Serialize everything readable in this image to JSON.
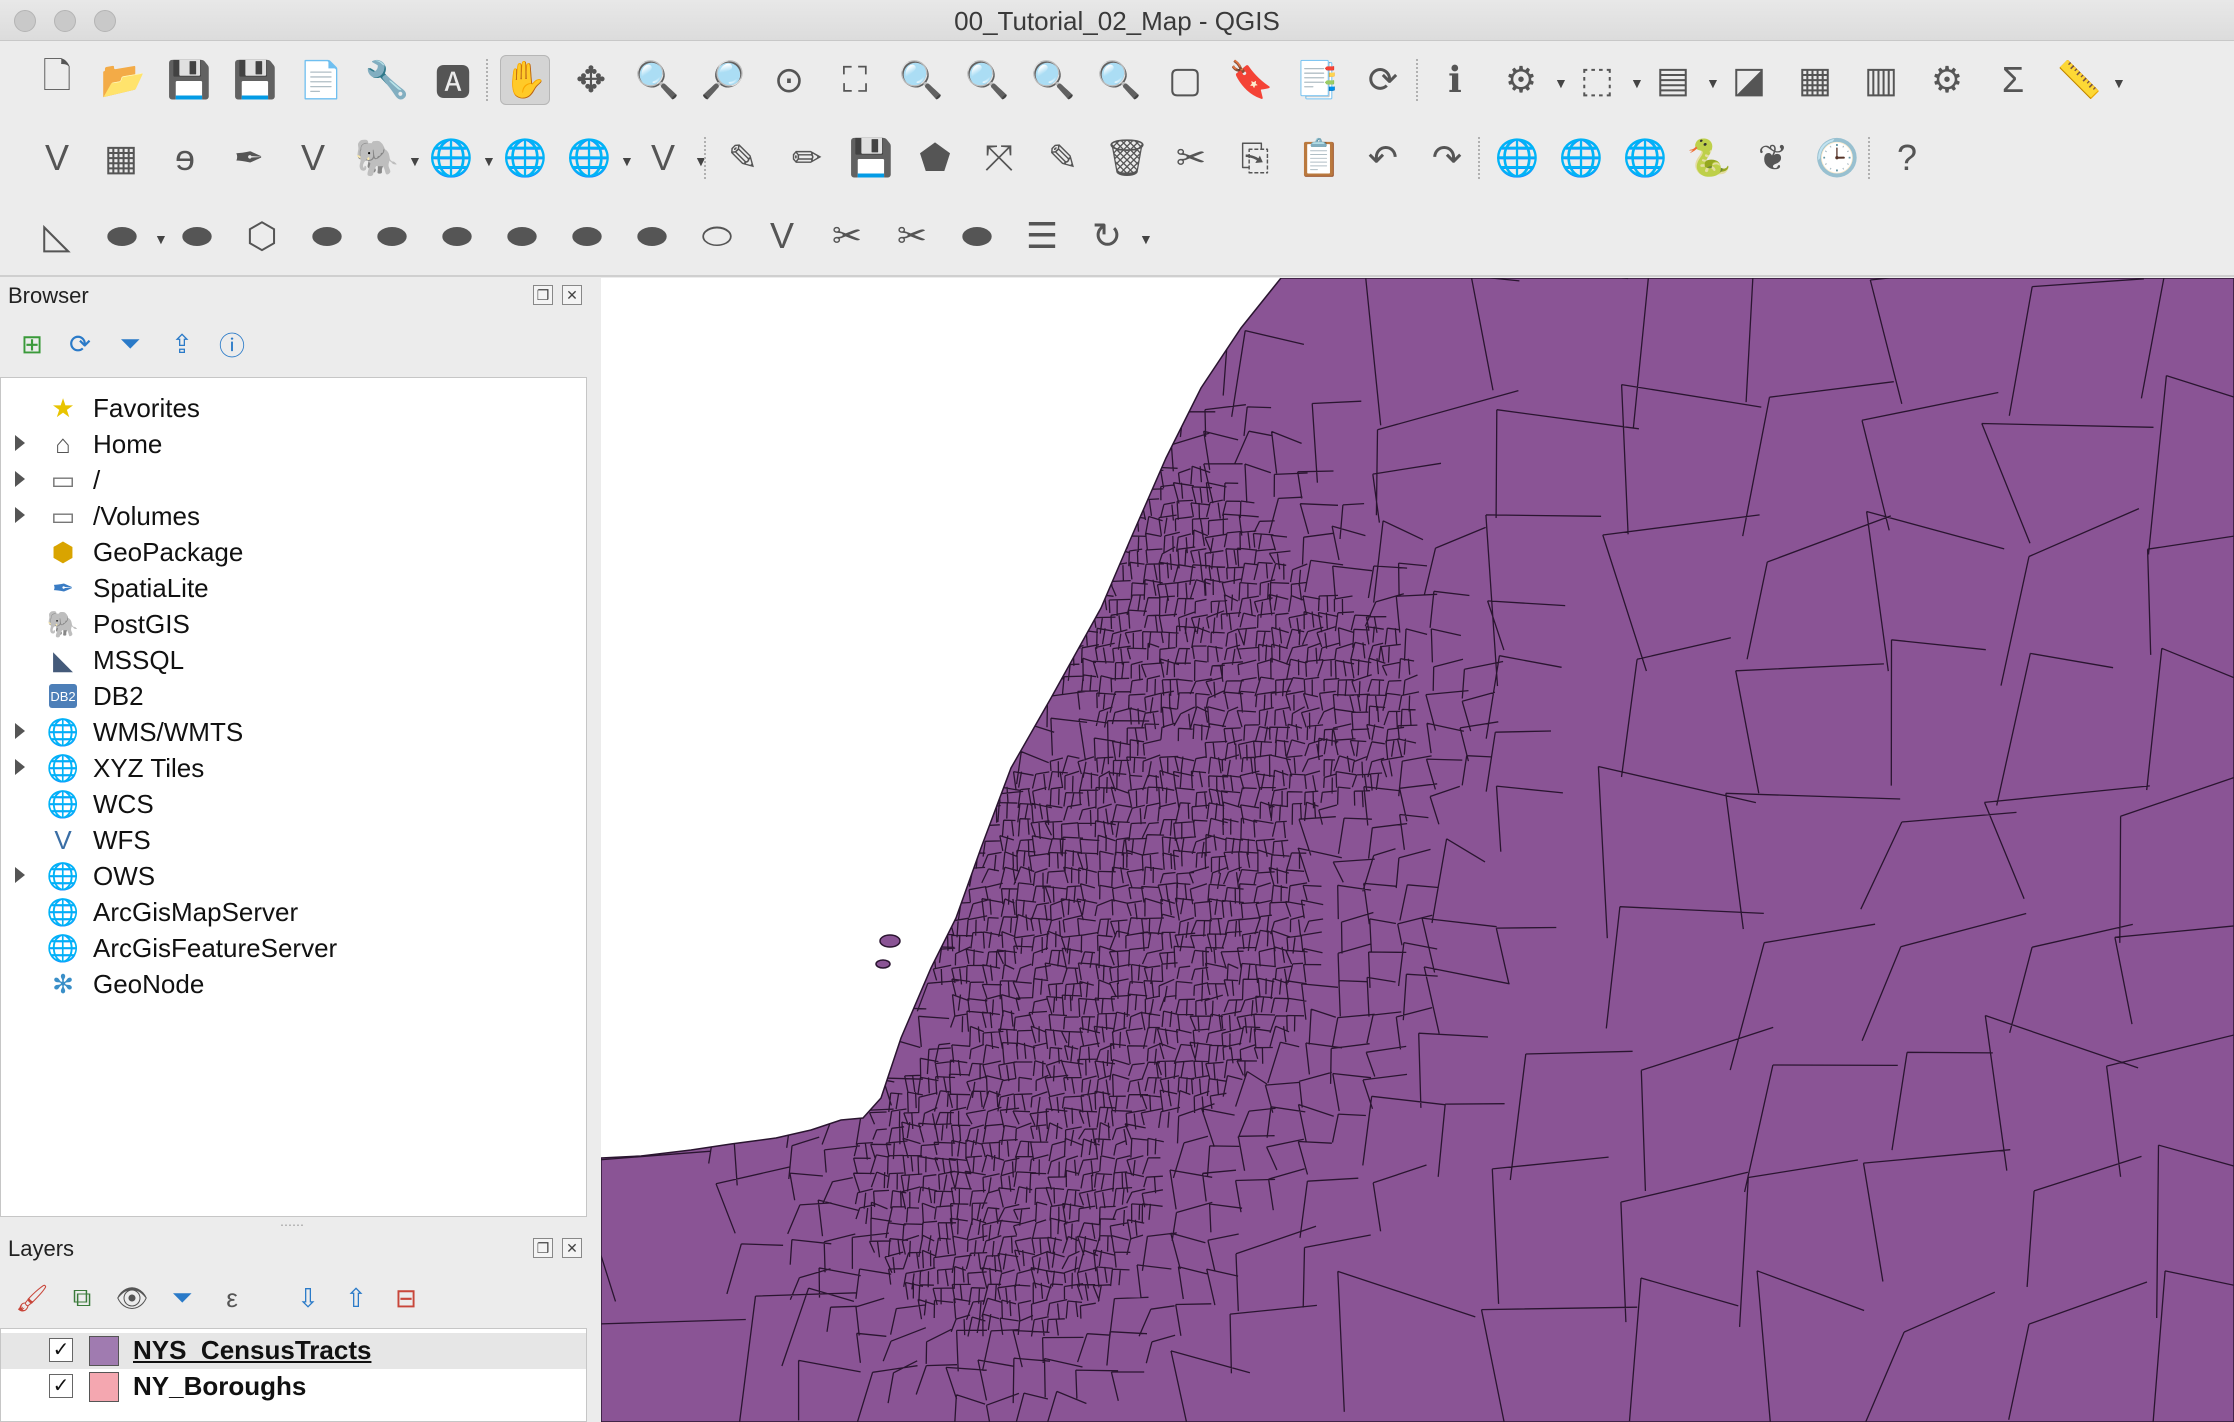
{
  "window": {
    "title": "00_Tutorial_02_Map - QGIS"
  },
  "colors": {
    "map_fill": "#8a5495",
    "map_stroke": "#2a1530",
    "census_swatch": "#a07bb0",
    "boroughs_swatch": "#f4a7b0",
    "accent": "#1e6fd9"
  },
  "toolbar_row1": [
    {
      "name": "new-project-icon",
      "glyph": "🗋"
    },
    {
      "name": "open-project-icon",
      "glyph": "📂"
    },
    {
      "name": "save-project-icon",
      "glyph": "💾"
    },
    {
      "name": "save-as-icon",
      "glyph": "💾"
    },
    {
      "name": "new-print-layout-icon",
      "glyph": "📄"
    },
    {
      "name": "layout-manager-icon",
      "glyph": "🔧"
    },
    {
      "name": "style-manager-icon",
      "glyph": "🅰"
    },
    {
      "name": "pan-map-icon",
      "glyph": "✋"
    },
    {
      "name": "pan-to-selection-icon",
      "glyph": "✥"
    },
    {
      "name": "zoom-in-icon",
      "glyph": "🔍"
    },
    {
      "name": "zoom-out-icon",
      "glyph": "🔎"
    },
    {
      "name": "zoom-native-icon",
      "glyph": "⊙"
    },
    {
      "name": "zoom-full-icon",
      "glyph": "⛶"
    },
    {
      "name": "zoom-to-selection-icon",
      "glyph": "🔍"
    },
    {
      "name": "zoom-to-layer-icon",
      "glyph": "🔍"
    },
    {
      "name": "zoom-last-icon",
      "glyph": "🔍"
    },
    {
      "name": "zoom-next-icon",
      "glyph": "🔍"
    },
    {
      "name": "new-map-view-icon",
      "glyph": "▢"
    },
    {
      "name": "new-bookmark-icon",
      "glyph": "🔖"
    },
    {
      "name": "show-bookmarks-icon",
      "glyph": "📑"
    },
    {
      "name": "refresh-icon",
      "glyph": "⟳"
    },
    {
      "name": "identify-features-icon",
      "glyph": "ℹ"
    },
    {
      "name": "run-action-icon",
      "glyph": "⚙"
    },
    {
      "name": "select-features-icon",
      "glyph": "⬚"
    },
    {
      "name": "select-by-value-icon",
      "glyph": "▤"
    },
    {
      "name": "deselect-all-icon",
      "glyph": "◪"
    },
    {
      "name": "attribute-table-icon",
      "glyph": "▦"
    },
    {
      "name": "statistical-summary-icon",
      "glyph": "▥"
    },
    {
      "name": "toolbox-icon",
      "glyph": "⚙"
    },
    {
      "name": "sum-icon",
      "glyph": "Σ"
    },
    {
      "name": "measure-icon",
      "glyph": "📏"
    }
  ],
  "toolbar_row2": [
    {
      "name": "new-vector-layer-icon",
      "glyph": "V"
    },
    {
      "name": "new-raster-layer-icon",
      "glyph": "▦"
    },
    {
      "name": "add-delimited-text-icon",
      "glyph": "ɘ"
    },
    {
      "name": "add-spatialite-icon",
      "glyph": "✒"
    },
    {
      "name": "add-virtual-layer-icon",
      "glyph": "V"
    },
    {
      "name": "add-postgis-icon",
      "glyph": "🐘"
    },
    {
      "name": "add-wms-icon",
      "glyph": "🌐"
    },
    {
      "name": "add-wcs-icon",
      "glyph": "🌐"
    },
    {
      "name": "add-wfs-icon",
      "glyph": "🌐"
    },
    {
      "name": "add-vector-icon",
      "glyph": "V"
    },
    {
      "name": "current-edits-icon",
      "glyph": "✎"
    },
    {
      "name": "toggle-editing-icon",
      "glyph": "✏"
    },
    {
      "name": "save-edits-icon",
      "glyph": "💾"
    },
    {
      "name": "add-feature-icon",
      "glyph": "⬟"
    },
    {
      "name": "vertex-tool-icon",
      "glyph": "⤧"
    },
    {
      "name": "modify-attributes-icon",
      "glyph": "✎"
    },
    {
      "name": "delete-selected-icon",
      "glyph": "🗑"
    },
    {
      "name": "cut-features-icon",
      "glyph": "✂"
    },
    {
      "name": "copy-features-icon",
      "glyph": "⎘"
    },
    {
      "name": "paste-features-icon",
      "glyph": "📋"
    },
    {
      "name": "undo-icon",
      "glyph": "↶"
    },
    {
      "name": "redo-icon",
      "glyph": "↷"
    },
    {
      "name": "add-xyz-icon",
      "glyph": "🌐"
    },
    {
      "name": "search-wms-icon",
      "glyph": "🌐"
    },
    {
      "name": "metasearch-icon",
      "glyph": "🌐"
    },
    {
      "name": "python-console-icon",
      "glyph": "🐍"
    },
    {
      "name": "grass-icon",
      "glyph": "❦"
    },
    {
      "name": "temporal-controller-icon",
      "glyph": "🕒"
    },
    {
      "name": "help-icon",
      "glyph": "?"
    }
  ],
  "toolbar_row3": [
    {
      "name": "digitize-angle-icon",
      "glyph": "◺"
    },
    {
      "name": "move-feature-icon",
      "glyph": "⬬"
    },
    {
      "name": "rotate-feature-icon",
      "glyph": "⬬"
    },
    {
      "name": "simplify-icon",
      "glyph": "⬡"
    },
    {
      "name": "add-ring-icon",
      "glyph": "⬬"
    },
    {
      "name": "add-part-icon",
      "glyph": "⬬"
    },
    {
      "name": "fill-ring-icon",
      "glyph": "⬬"
    },
    {
      "name": "delete-ring-icon",
      "glyph": "⬬"
    },
    {
      "name": "delete-part-icon",
      "glyph": "⬬"
    },
    {
      "name": "reshape-icon",
      "glyph": "⬬"
    },
    {
      "name": "offset-curve-icon",
      "glyph": "⬭"
    },
    {
      "name": "reverse-line-icon",
      "glyph": "V"
    },
    {
      "name": "split-features-icon",
      "glyph": "✂"
    },
    {
      "name": "split-parts-icon",
      "glyph": "✂"
    },
    {
      "name": "merge-features-icon",
      "glyph": "⬬"
    },
    {
      "name": "merge-attributes-icon",
      "glyph": "☰"
    },
    {
      "name": "rotate-point-icon",
      "glyph": "↻"
    }
  ],
  "browser": {
    "title": "Browser",
    "items": [
      {
        "label": "Favorites",
        "icon": "star-icon",
        "glyph": "★",
        "color": "#e8c400",
        "expandable": false
      },
      {
        "label": "Home",
        "icon": "home-icon",
        "glyph": "⌂",
        "color": "#555",
        "expandable": true
      },
      {
        "label": "/",
        "icon": "folder-icon",
        "glyph": "▭",
        "color": "#777",
        "expandable": true
      },
      {
        "label": "/Volumes",
        "icon": "folder-icon",
        "glyph": "▭",
        "color": "#777",
        "expandable": true
      },
      {
        "label": "GeoPackage",
        "icon": "geopackage-icon",
        "glyph": "⬢",
        "color": "#d9a400",
        "expandable": false
      },
      {
        "label": "SpatiaLite",
        "icon": "spatialite-icon",
        "glyph": "✒",
        "color": "#3a7cc4",
        "expandable": false
      },
      {
        "label": "PostGIS",
        "icon": "postgis-icon",
        "glyph": "🐘",
        "color": "#33679a",
        "expandable": false
      },
      {
        "label": "MSSQL",
        "icon": "mssql-icon",
        "glyph": "◣",
        "color": "#445a7a",
        "expandable": false
      },
      {
        "label": "DB2",
        "icon": "db2-icon",
        "glyph": "DB2",
        "color": "#4d7fb8",
        "expandable": false
      },
      {
        "label": "WMS/WMTS",
        "icon": "wms-globe-icon",
        "glyph": "🌐",
        "color": "#3a6ea5",
        "expandable": true
      },
      {
        "label": "XYZ Tiles",
        "icon": "xyz-globe-icon",
        "glyph": "🌐",
        "color": "#3a6ea5",
        "expandable": true
      },
      {
        "label": "WCS",
        "icon": "wcs-globe-icon",
        "glyph": "🌐",
        "color": "#2d5f95",
        "expandable": false
      },
      {
        "label": "WFS",
        "icon": "wfs-icon",
        "glyph": "V",
        "color": "#3a6ea5",
        "expandable": false
      },
      {
        "label": "OWS",
        "icon": "ows-globe-icon",
        "glyph": "🌐",
        "color": "#3a6ea5",
        "expandable": true
      },
      {
        "label": "ArcGisMapServer",
        "icon": "arcgis-map-icon",
        "glyph": "🌐",
        "color": "#3a6ea5",
        "expandable": false
      },
      {
        "label": "ArcGisFeatureServer",
        "icon": "arcgis-feature-icon",
        "glyph": "🌐",
        "color": "#3a6ea5",
        "expandable": false
      },
      {
        "label": "GeoNode",
        "icon": "geonode-icon",
        "glyph": "✻",
        "color": "#3a8fc8",
        "expandable": false
      }
    ]
  },
  "layers": {
    "title": "Layers",
    "items": [
      {
        "label": "NYS_CensusTracts",
        "checked": "✓",
        "selected": true
      },
      {
        "label": "NY_Boroughs",
        "checked": "✓",
        "selected": false
      }
    ]
  }
}
